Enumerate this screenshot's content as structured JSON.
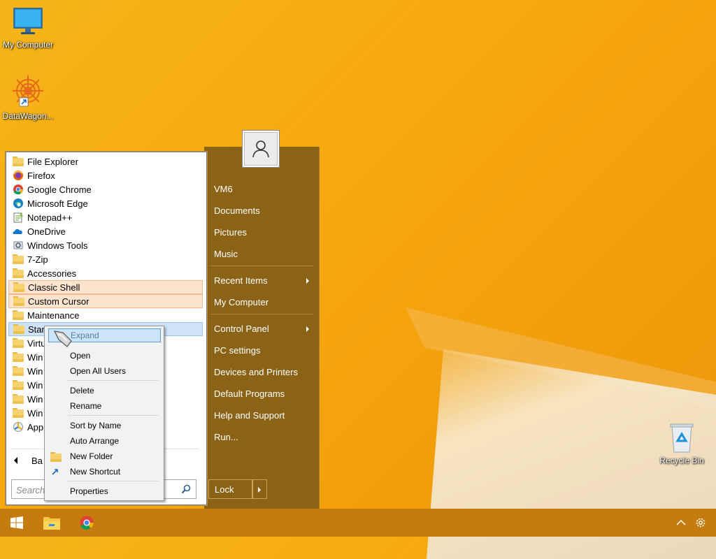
{
  "desktop": {
    "icons": [
      {
        "label": "My Computer"
      },
      {
        "label": "DataWagon..."
      },
      {
        "label": "Recycle Bin"
      }
    ]
  },
  "start_menu": {
    "programs": [
      {
        "label": "File Explorer",
        "icon": "file-explorer-icon"
      },
      {
        "label": "Firefox",
        "icon": "firefox-icon"
      },
      {
        "label": "Google Chrome",
        "icon": "chrome-icon"
      },
      {
        "label": "Microsoft Edge",
        "icon": "edge-icon"
      },
      {
        "label": "Notepad++",
        "icon": "notepad-icon"
      },
      {
        "label": "OneDrive",
        "icon": "onedrive-icon"
      },
      {
        "label": "Windows Tools",
        "icon": "windows-tools-icon"
      },
      {
        "label": "7-Zip",
        "icon": "folder-icon"
      },
      {
        "label": "Accessories",
        "icon": "folder-icon"
      },
      {
        "label": "Classic Shell",
        "icon": "folder-icon"
      },
      {
        "label": "Custom Cursor",
        "icon": "folder-icon"
      },
      {
        "label": "Maintenance",
        "icon": "folder-icon"
      },
      {
        "label": "Star",
        "icon": "folder-icon"
      },
      {
        "label": "Virtu",
        "icon": "folder-icon"
      },
      {
        "label": "Win",
        "icon": "folder-icon"
      },
      {
        "label": "Win",
        "icon": "folder-icon"
      },
      {
        "label": "Win",
        "icon": "folder-icon"
      },
      {
        "label": "Win",
        "icon": "folder-icon"
      },
      {
        "label": "Win",
        "icon": "folder-icon"
      },
      {
        "label": "App",
        "icon": "apps-icon"
      }
    ],
    "back_label": "Ba",
    "search_placeholder": "Search",
    "right_items": [
      {
        "label": "VM6"
      },
      {
        "label": "Documents"
      },
      {
        "label": "Pictures"
      },
      {
        "label": "Music"
      },
      {
        "label": "Recent Items",
        "submenu": true
      },
      {
        "label": "My Computer"
      },
      {
        "label": "Control Panel",
        "submenu": true
      },
      {
        "label": "PC settings"
      },
      {
        "label": "Devices and Printers"
      },
      {
        "label": "Default Programs"
      },
      {
        "label": "Help and Support"
      },
      {
        "label": "Run..."
      }
    ],
    "lock_label": "Lock"
  },
  "context_menu": {
    "expand": "Expand",
    "items": [
      "Open",
      "Open All Users",
      "Delete",
      "Rename",
      "Sort by Name",
      "Auto Arrange",
      "New Folder",
      "New Shortcut",
      "Properties"
    ]
  },
  "colors": {
    "accent": "#8b6317",
    "highlight": "#fde4cf",
    "selection": "#cfe3f8",
    "taskbar": "#d98a10"
  }
}
